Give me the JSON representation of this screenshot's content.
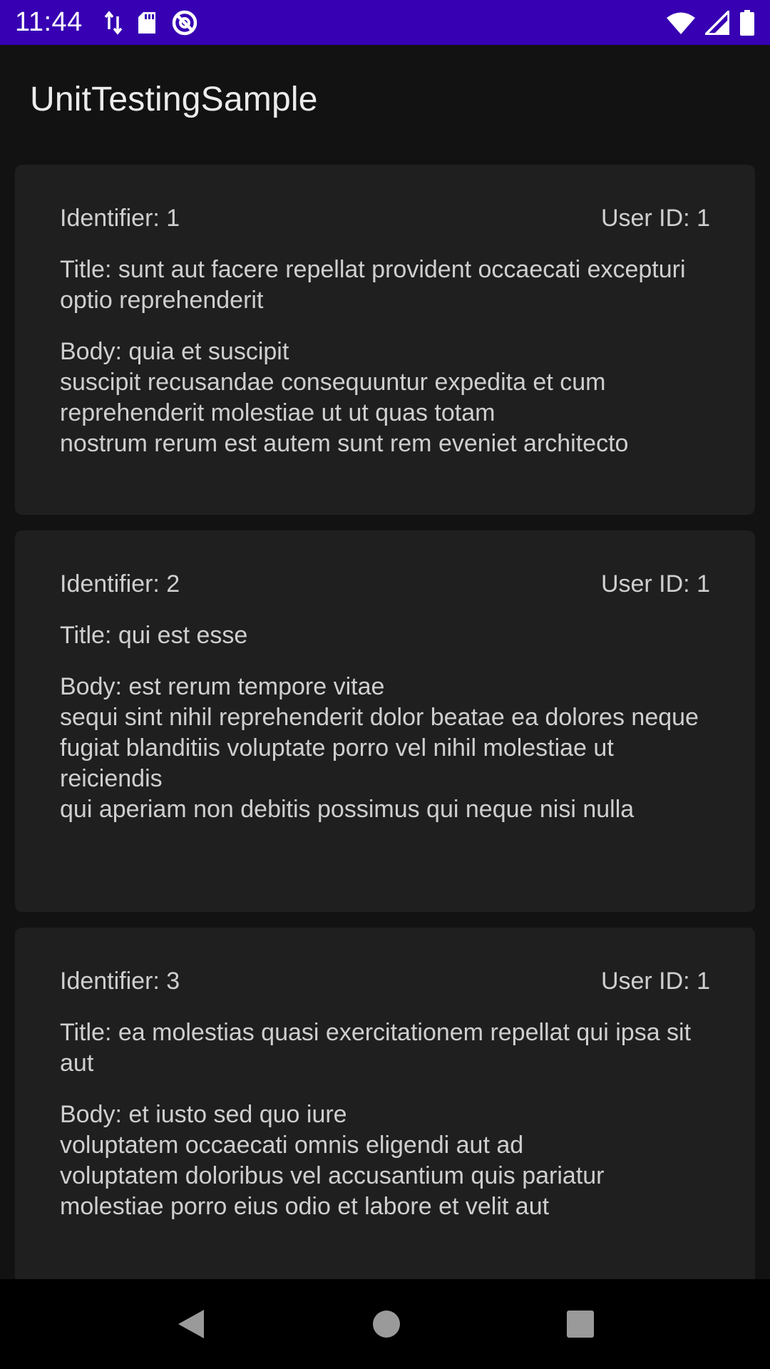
{
  "status_bar": {
    "time": "11:44",
    "left_icons": [
      "data-transfer-icon",
      "sd-card-icon",
      "sync-icon"
    ],
    "right_icons": [
      "wifi-icon",
      "signal-icon",
      "battery-icon"
    ]
  },
  "app_bar": {
    "title": "UnitTestingSample"
  },
  "posts": [
    {
      "identifier": "Identifier: 1",
      "user_id": "User ID: 1",
      "title": "Title: sunt aut facere repellat provident occaecati excepturi optio reprehenderit",
      "body": "Body: quia et suscipit\nsuscipit recusandae consequuntur expedita et cum reprehenderit molestiae ut ut quas totam\nnostrum rerum est autem sunt rem eveniet architecto"
    },
    {
      "identifier": "Identifier: 2",
      "user_id": "User ID: 1",
      "title": "Title: qui est esse",
      "body": "Body: est rerum tempore vitae\nsequi sint nihil reprehenderit dolor beatae ea dolores neque\nfugiat blanditiis voluptate porro vel nihil molestiae ut reiciendis\nqui aperiam non debitis possimus qui neque nisi nulla"
    },
    {
      "identifier": "Identifier: 3",
      "user_id": "User ID: 1",
      "title": "Title: ea molestias quasi exercitationem repellat qui ipsa sit aut",
      "body": "Body: et iusto sed quo iure\nvoluptatem occaecati omnis eligendi aut ad\nvoluptatem doloribus vel accusantium quis pariatur\nmolestiae porro eius odio et labore et velit aut"
    }
  ],
  "nav_bar": {
    "buttons": [
      "back-icon",
      "home-icon",
      "recents-icon"
    ]
  },
  "colors": {
    "status_bar": "#3700b3",
    "background": "#121212",
    "card": "#1f1f1f",
    "text": "#cfcfcf"
  }
}
